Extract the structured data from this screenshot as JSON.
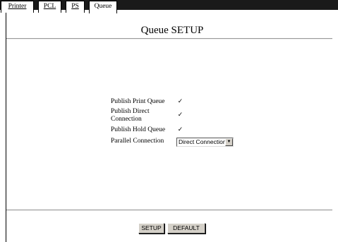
{
  "tabs": [
    {
      "label": "Printer",
      "active": false
    },
    {
      "label": "PCL",
      "active": false
    },
    {
      "label": "PS",
      "active": false
    },
    {
      "label": "Queue",
      "active": true
    }
  ],
  "page": {
    "title": "Queue SETUP"
  },
  "form": {
    "publish_print_queue": {
      "label": "Publish Print Queue",
      "checked": true
    },
    "publish_direct_connection": {
      "label": "Publish Direct Connection",
      "checked": true
    },
    "publish_hold_queue": {
      "label": "Publish Hold Queue",
      "checked": true
    },
    "parallel_connection": {
      "label": "Parallel Connection",
      "value": "Direct Connection"
    }
  },
  "buttons": {
    "setup": "SETUP",
    "default": "DEFAULT"
  },
  "icons": {
    "checkmark": "check-icon",
    "dropdown": "chevron-down-icon"
  },
  "colors": {
    "tab_bar": "#1a1a1a",
    "button_face": "#d4d0c8",
    "background": "#ffffff"
  }
}
